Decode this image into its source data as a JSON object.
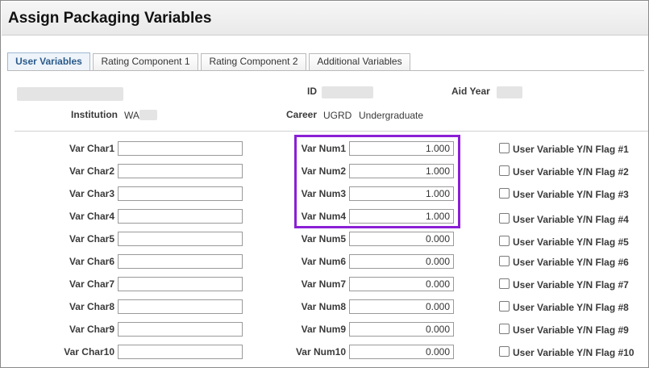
{
  "page": {
    "title": "Assign Packaging Variables"
  },
  "tabs": [
    {
      "label": "User Variables",
      "active": true
    },
    {
      "label": "Rating Component 1",
      "active": false
    },
    {
      "label": "Rating Component 2",
      "active": false
    },
    {
      "label": "Additional Variables",
      "active": false
    }
  ],
  "header": {
    "id_label": "ID",
    "aid_year_label": "Aid Year",
    "institution_label": "Institution",
    "institution_value": "WA",
    "career_label": "Career",
    "career_code": "UGRD",
    "career_desc": "Undergraduate"
  },
  "rows": [
    {
      "char_label": "Var Char1",
      "char_value": "",
      "num_label": "Var Num1",
      "num_value": "1.000",
      "flag_label": "User Variable Y/N Flag #1"
    },
    {
      "char_label": "Var Char2",
      "char_value": "",
      "num_label": "Var Num2",
      "num_value": "1.000",
      "flag_label": "User Variable Y/N Flag #2"
    },
    {
      "char_label": "Var Char3",
      "char_value": "",
      "num_label": "Var Num3",
      "num_value": "1.000",
      "flag_label": "User Variable Y/N Flag #3"
    },
    {
      "char_label": "Var Char4",
      "char_value": "",
      "num_label": "Var Num4",
      "num_value": "1.000",
      "flag_label": "User Variable Y/N Flag #4"
    },
    {
      "char_label": "Var Char5",
      "char_value": "",
      "num_label": "Var Num5",
      "num_value": "0.000",
      "flag_label": "User Variable Y/N Flag #5"
    },
    {
      "char_label": "Var Char6",
      "char_value": "",
      "num_label": "Var Num6",
      "num_value": "0.000",
      "flag_label": "User Variable Y/N Flag #6"
    },
    {
      "char_label": "Var Char7",
      "char_value": "",
      "num_label": "Var Num7",
      "num_value": "0.000",
      "flag_label": "User Variable Y/N Flag #7"
    },
    {
      "char_label": "Var Char8",
      "char_value": "",
      "num_label": "Var Num8",
      "num_value": "0.000",
      "flag_label": "User Variable Y/N Flag #8"
    },
    {
      "char_label": "Var Char9",
      "char_value": "",
      "num_label": "Var Num9",
      "num_value": "0.000",
      "flag_label": "User Variable Y/N Flag #9"
    },
    {
      "char_label": "Var Char10",
      "char_value": "",
      "num_label": "Var Num10",
      "num_value": "0.000",
      "flag_label": "User Variable Y/N Flag #10"
    }
  ],
  "colors": {
    "highlight": "#8b1fd6",
    "active_tab_text": "#2a5a8a"
  }
}
